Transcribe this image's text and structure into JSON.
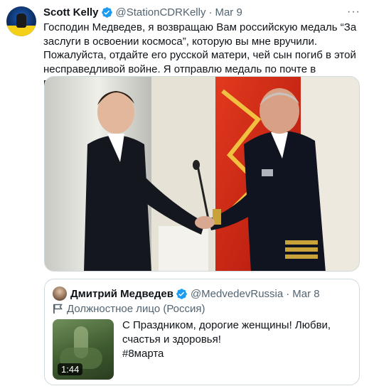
{
  "tweet": {
    "author_name": "Scott Kelly",
    "author_handle": "@StationCDRKelly",
    "separator": "·",
    "time": "Mar 9",
    "more": "···",
    "text": "Господин Медведев, я возвращаю Вам российскую медаль “За заслуги в освоении космоса”, которую вы мне вручили. Пожалуйста, отдайте его русской матери, чей сын погиб в этой несправедливой войне. Я отправлю медаль по почте в посольство России в Вашингтоне. Удачи."
  },
  "quote": {
    "author_name": "Дмитрий Медведев",
    "author_handle": "@MedvedevRussia",
    "separator": "·",
    "time": "Mar 8",
    "label": "Должностное лицо (Россия)",
    "text": "С Праздником, дорогие женщины! Любви, счастья и здоровья!",
    "hashtag": "#8марта",
    "video_duration": "1:44"
  },
  "colors": {
    "verified": "#1d9bf0",
    "secondary_text": "#536471",
    "border": "#cfd9de"
  },
  "icons": {
    "verified": "verified-badge-icon",
    "more": "more-icon",
    "flag": "flag-icon"
  }
}
